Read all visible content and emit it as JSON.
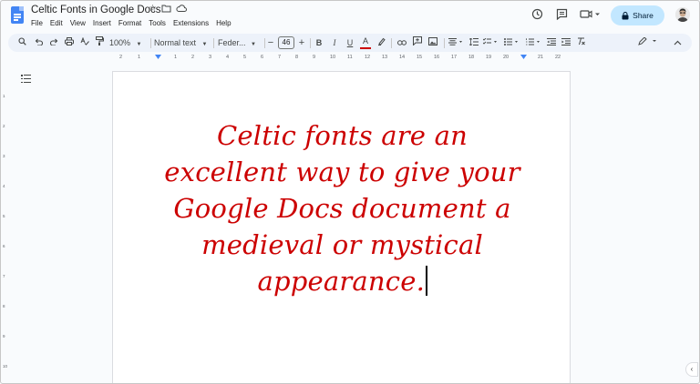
{
  "window": {
    "title": "Celtic Fonts in Google Docs"
  },
  "menu": [
    "File",
    "Edit",
    "View",
    "Insert",
    "Format",
    "Tools",
    "Extensions",
    "Help"
  ],
  "title_icons": [
    "star-icon",
    "move-folder-icon",
    "cloud-status-icon"
  ],
  "header_actions": {
    "history_icon": "history-icon",
    "comments_icon": "comments-icon",
    "meet_icon": "meet-icon",
    "share_label": "Share"
  },
  "toolbar": {
    "zoom": "100%",
    "style": "Normal text",
    "font": "Feder...",
    "font_size": "46",
    "minus": "−",
    "plus": "+",
    "bold": "B",
    "italic": "I",
    "underline": "U",
    "text_color": "A"
  },
  "ruler": {
    "labels": [
      "2",
      "1",
      "1",
      "2",
      "3",
      "4",
      "5",
      "6",
      "7",
      "8",
      "9",
      "10",
      "11",
      "12",
      "13",
      "14",
      "15",
      "16",
      "17",
      "18",
      "19",
      "20",
      "21",
      "22"
    ]
  },
  "vertical_ruler": {
    "labels": [
      "1",
      "2",
      "3",
      "4",
      "5",
      "6",
      "7",
      "8",
      "9",
      "10"
    ]
  },
  "document": {
    "lines": [
      "Celtic fonts are an",
      "excellent way to give your",
      "Google Docs document a",
      "medieval or mystical",
      "appearance."
    ],
    "text_color": "#cc0000"
  },
  "colors": {
    "share_bg": "#c2e7ff",
    "toolbar_bg": "#edf2fa",
    "docs_blue": "#4285f4"
  }
}
